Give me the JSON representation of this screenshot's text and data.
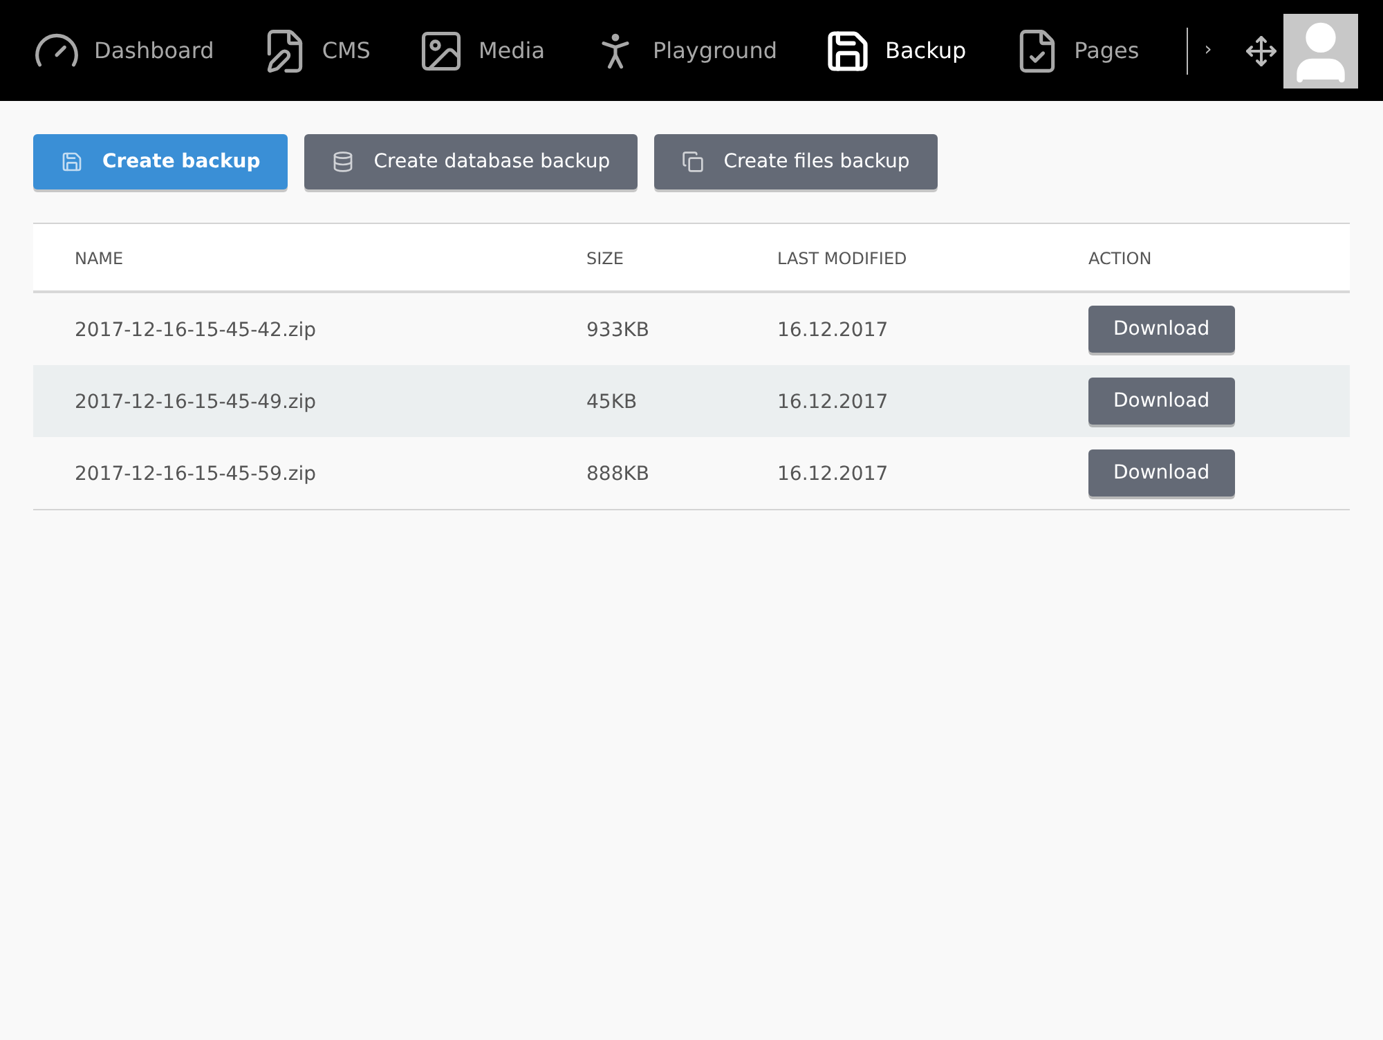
{
  "nav": {
    "items": [
      {
        "label": "Dashboard",
        "selected": false
      },
      {
        "label": "CMS",
        "selected": false
      },
      {
        "label": "Media",
        "selected": false
      },
      {
        "label": "Playground",
        "selected": false
      },
      {
        "label": "Backup",
        "selected": true
      },
      {
        "label": "Pages",
        "selected": false
      }
    ],
    "more": "›"
  },
  "actions": [
    {
      "label": "Create backup",
      "kind": "primary"
    },
    {
      "label": "Create database backup",
      "kind": "secondary"
    },
    {
      "label": "Create files backup",
      "kind": "secondary"
    }
  ],
  "table": {
    "columns": [
      "NAME",
      "SIZE",
      "LAST MODIFIED",
      "ACTION"
    ],
    "rows": [
      {
        "name": "2017-12-16-15-45-42.zip",
        "size": "933KB",
        "modified": "16.12.2017",
        "action": "Download"
      },
      {
        "name": "2017-12-16-15-45-49.zip",
        "size": "45KB",
        "modified": "16.12.2017",
        "action": "Download"
      },
      {
        "name": "2017-12-16-15-45-59.zip",
        "size": "888KB",
        "modified": "16.12.2017",
        "action": "Download"
      }
    ]
  }
}
